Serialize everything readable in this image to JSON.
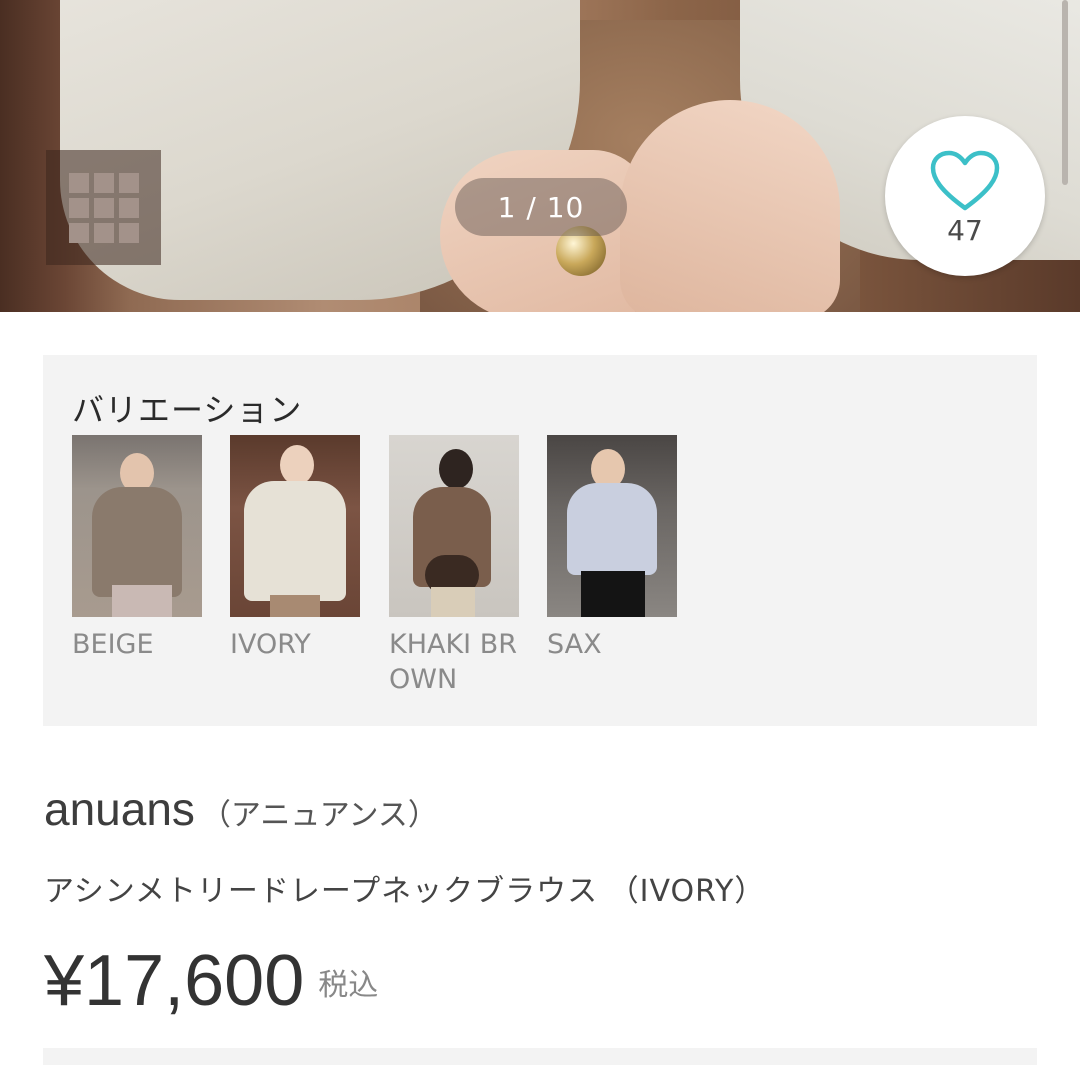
{
  "hero": {
    "counter": "1 / 10",
    "favorite_count": "47",
    "accent_color": "#3cc0c8"
  },
  "variation": {
    "title": "バリエーション",
    "items": [
      {
        "label": "BEIGE"
      },
      {
        "label": "IVORY"
      },
      {
        "label": "KHAKI BROWN"
      },
      {
        "label": "SAX"
      }
    ]
  },
  "product": {
    "brand": "anuans",
    "brand_kana": "（アニュアンス）",
    "name": "アシンメトリードレープネックブラウス （IVORY）",
    "price": "¥17,600",
    "tax_label": "税込"
  }
}
